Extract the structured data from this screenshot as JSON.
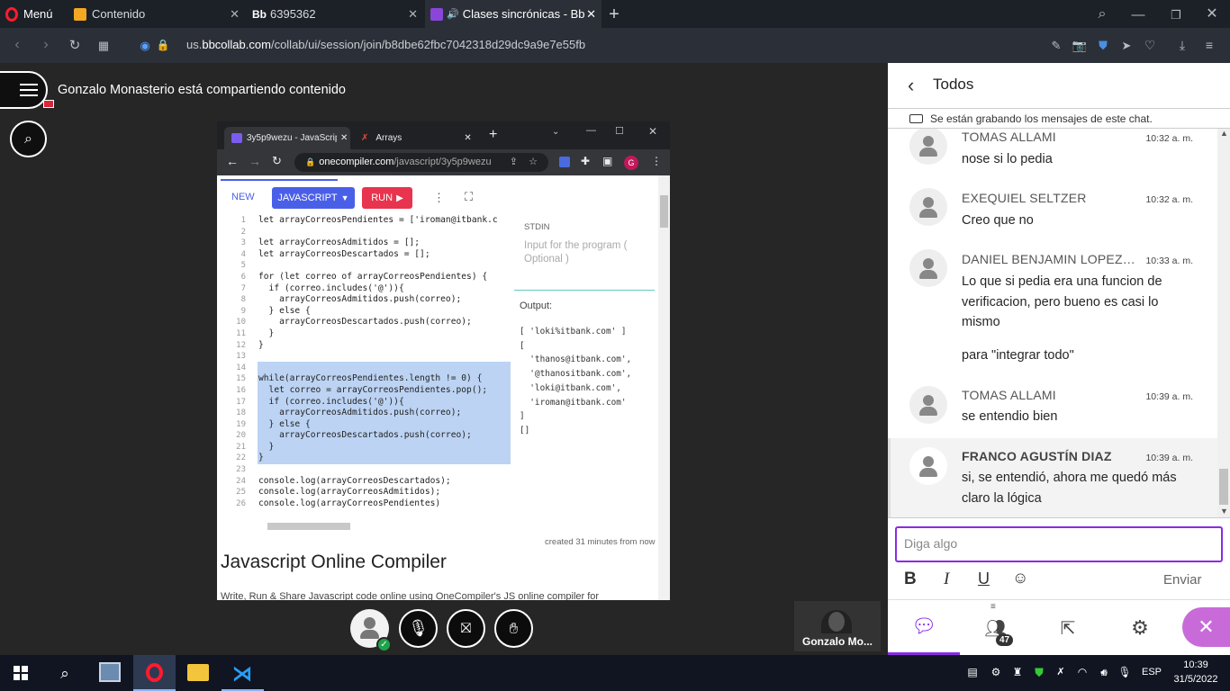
{
  "browser": {
    "menu_label": "Menú",
    "tabs": [
      {
        "label": "Contenido",
        "icon": "contenido-tab-icon"
      },
      {
        "label": "6395362",
        "icon": "bb-tab-icon",
        "prefix": "Bb"
      },
      {
        "label": "Clases sincrónicas - Bb",
        "icon": "collab-tab-icon",
        "prefix": "Bb"
      }
    ],
    "url_host": "us.bbcollab.com",
    "url_path": "/collab/ui/session/join/b8dbe62fbc7042318d29dc9a9e7e55fb",
    "url_prefix": "us."
  },
  "session": {
    "sharing_text": "Gonzalo Monasterio está compartiendo contenido",
    "participant_name": "Gonzalo Mo...",
    "participants_badge": "47"
  },
  "shared_window": {
    "tabs": [
      {
        "label": "3y5p9wezu - JavaScrip"
      },
      {
        "label": "Arrays"
      }
    ],
    "url_domain": "onecompiler.com",
    "url_path": "/javascript/3y5p9wezu",
    "profile_initial": "G",
    "toolbar": {
      "new": "NEW",
      "language": "JAVASCRIPT",
      "run": "RUN"
    },
    "stdin_label": "STDIN",
    "stdin_placeholder_1": "Input for the program (",
    "stdin_placeholder_2": "Optional )",
    "output_label": "Output:",
    "output_lines": [
      "[ 'loki%itbank.com' ]",
      "[",
      "  'thanos@itbank.com',",
      "  '@thanositbank.com',",
      "  'loki@itbank.com',",
      "  'iroman@itbank.com'",
      "]",
      "[]"
    ],
    "code_lines": [
      "let arrayCorreosPendientes = ['iroman@itbank.c",
      "",
      "let arrayCorreosAdmitidos = [];",
      "let arrayCorreosDescartados = [];",
      "",
      "for (let correo of arrayCorreosPendientes) {",
      "  if (correo.includes('@')){",
      "    arrayCorreosAdmitidos.push(correo);",
      "  } else {",
      "    arrayCorreosDescartados.push(correo);",
      "  }",
      "}",
      "",
      "",
      "while(arrayCorreosPendientes.length != 0) {",
      "  let correo = arrayCorreosPendientes.pop();",
      "  if (correo.includes('@')){",
      "    arrayCorreosAdmitidos.push(correo);",
      "  } else {",
      "    arrayCorreosDescartados.push(correo);",
      "  }",
      "}",
      "",
      "console.log(arrayCorreosDescartados);",
      "console.log(arrayCorreosAdmitidos);",
      "console.log(arrayCorreosPendientes)"
    ],
    "line_numbers": [
      "1",
      "2",
      "3",
      "4",
      "5",
      "6",
      "7",
      "8",
      "9",
      "10",
      "11",
      "12",
      "13",
      "14",
      "15",
      "16",
      "17",
      "18",
      "19",
      "20",
      "21",
      "22",
      "23",
      "24",
      "25",
      "26"
    ],
    "created_text": "created 31 minutes from now",
    "heading": "Javascript Online Compiler",
    "description": "Write, Run & Share Javascript code online using OneCompiler's JS online compiler for"
  },
  "chat": {
    "title": "Todos",
    "recording_notice": "Se están grabando los mensajes de este chat.",
    "messages": [
      {
        "name": "TOMAS ALLAMI",
        "time": "10:32 a. m.",
        "texts": [
          "nose si lo pedia"
        ]
      },
      {
        "name": "EXEQUIEL SELTZER",
        "time": "10:32 a. m.",
        "texts": [
          "Creo que no"
        ]
      },
      {
        "name": "DANIEL BENJAMIN LOPEZ G...",
        "time": "10:33 a. m.",
        "texts": [
          "Lo que si pedia era una funcion de verificacion, pero bueno es casi lo mismo",
          "para \"integrar todo\""
        ]
      },
      {
        "name": "TOMAS ALLAMI",
        "time": "10:39 a. m.",
        "texts": [
          "se entendio bien"
        ]
      },
      {
        "name": "FRANCO AGUSTÍN DIAZ",
        "time": "10:39 a. m.",
        "texts": [
          "si, se entendió, ahora me quedó más claro la lógica"
        ]
      }
    ],
    "input_placeholder": "Diga algo",
    "send_label": "Enviar"
  },
  "taskbar": {
    "language": "ESP",
    "time": "10:39",
    "date": "31/5/2022"
  },
  "colors": {
    "accent_purple": "#8a2be2",
    "close_button": "#c86bd9",
    "run_red": "#e8344e",
    "language_blue": "#4a5fe8"
  }
}
